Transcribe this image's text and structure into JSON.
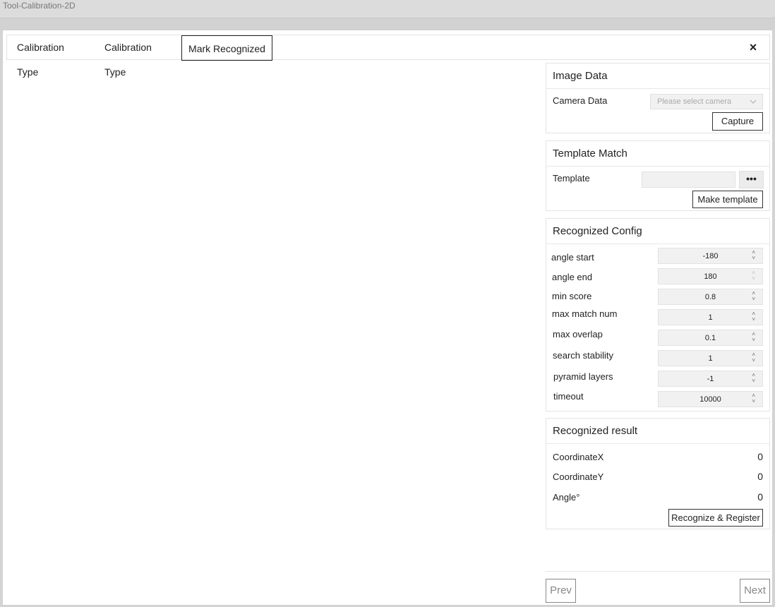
{
  "app": {
    "title": "Tool-Calibration-2D"
  },
  "tabs": [
    {
      "label": "Calibration Type"
    },
    {
      "label": "Calibration Type"
    },
    {
      "label": "Mark Recognized"
    }
  ],
  "close_icon": "×",
  "image_data": {
    "title": "Image Data",
    "camera_label": "Camera Data",
    "camera_placeholder": "Please select camera",
    "capture_label": "Capture"
  },
  "template_match": {
    "title": "Template Match",
    "template_label": "Template",
    "template_value": "",
    "browse_label": "•••",
    "make_label": "Make template"
  },
  "config": {
    "title": "Recognized Config",
    "fields": [
      {
        "label": "angle start",
        "value": "-180"
      },
      {
        "label": "angle end",
        "value": "180"
      },
      {
        "label": "min score",
        "value": "0.8"
      },
      {
        "label": "max match num",
        "value": "1"
      },
      {
        "label": "max overlap",
        "value": "0.1"
      },
      {
        "label": "search stability",
        "value": "1"
      },
      {
        "label": "pyramid layers",
        "value": "-1"
      },
      {
        "label": "timeout",
        "value": "10000"
      }
    ]
  },
  "result": {
    "title": "Recognized result",
    "rows": [
      {
        "label": "CoordinateX",
        "value": "0"
      },
      {
        "label": "CoordinateY",
        "value": "0"
      },
      {
        "label": "Angle°",
        "value": "0"
      }
    ],
    "register_label": "Recognize & Register"
  },
  "nav": {
    "prev_label": "Prev",
    "next_label": "Next"
  }
}
